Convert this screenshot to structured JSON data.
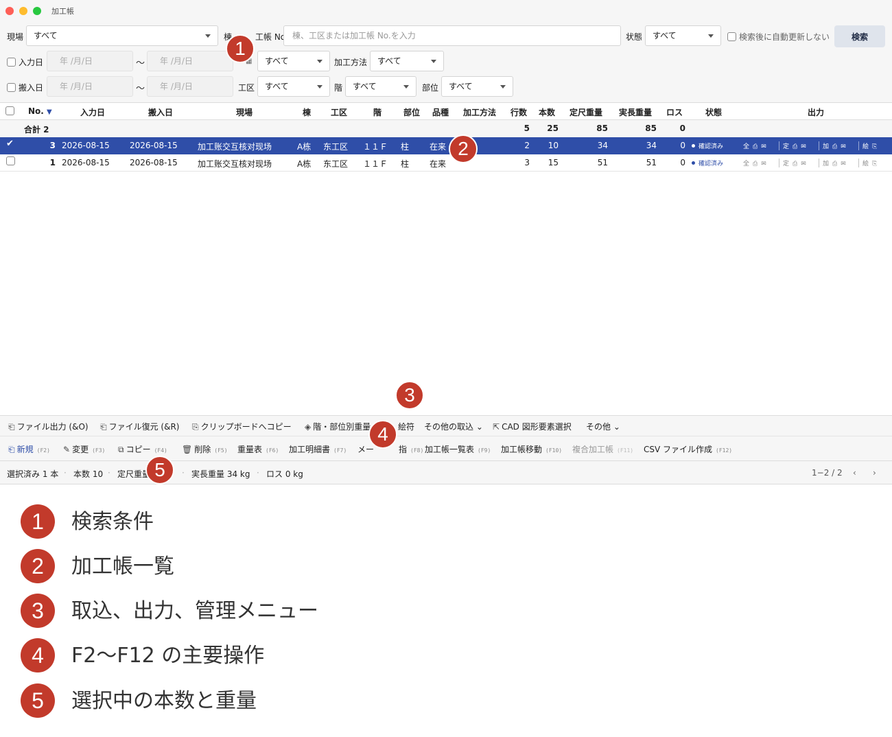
{
  "window": {
    "title": "加工帳"
  },
  "filters": {
    "site_label": "現場",
    "site_value": "すべて",
    "building_label": "棟",
    "ledger_label": "工帳 No.",
    "search_placeholder": "棟、工区または加工帳 No.を入力",
    "state_label": "状態",
    "state_value": "すべて",
    "auto_refresh_label": "検索後に自動更新しない",
    "search_button": "検索",
    "input_date_label": "入力日",
    "date_placeholder": "年 /月/日",
    "tilde": "〜",
    "floor_value": "すべて",
    "method_label": "加工方法",
    "method_value": "すべて",
    "delivery_date_label": "搬入日",
    "zone_label": "工区",
    "zone_value": "すべて",
    "level_label": "階",
    "level_value": "すべて",
    "part_label": "部位",
    "part_value": "すべて"
  },
  "table": {
    "headers": {
      "no": "No.",
      "input_date": "入力日",
      "delivery_date": "搬入日",
      "site": "現場",
      "building": "棟",
      "zone": "工区",
      "floor": "階",
      "part": "部位",
      "item": "品種",
      "method": "加工方法",
      "lines": "行数",
      "count": "本数",
      "fixed_weight": "定尺重量",
      "actual_weight": "実長重量",
      "loss": "ロス",
      "state": "状態",
      "output": "出力"
    },
    "total": {
      "label": "合計 2",
      "lines": "5",
      "count": "25",
      "fixed_weight": "85",
      "actual_weight": "85",
      "loss": "0"
    },
    "rows": [
      {
        "no": "3",
        "input_date": "2026-08-15",
        "delivery_date": "2026-08-15",
        "site": "加工账交互核对现场",
        "building": "A栋",
        "zone": "东工区",
        "floor": "１１Ｆ",
        "part": "柱",
        "item": "在来",
        "lines": "2",
        "count": "10",
        "fixed_weight": "34",
        "actual_weight": "34",
        "loss": "0",
        "state": "確認済み"
      },
      {
        "no": "1",
        "input_date": "2026-08-15",
        "delivery_date": "2026-08-15",
        "site": "加工账交互核对现场",
        "building": "A栋",
        "zone": "东工区",
        "floor": "１１Ｆ",
        "part": "柱",
        "item": "在来",
        "lines": "3",
        "count": "15",
        "fixed_weight": "51",
        "actual_weight": "51",
        "loss": "0",
        "state": "確認済み"
      }
    ],
    "output_groups": [
      "全",
      "定",
      "加",
      "絵"
    ]
  },
  "menu": {
    "file_output": "ファイル出力 (&O)",
    "file_restore": "ファイル復元 (&R)",
    "clipboard_copy": "クリップボードへコピー",
    "floor_weight": "階・部位別重量",
    "drawing": "絵符",
    "other_import": "その他の取込",
    "cad_select": "CAD 図形要素選択",
    "other": "その他"
  },
  "fkeys": {
    "new": "新規",
    "new_key": "(F2)",
    "change": "変更",
    "change_key": "(F3)",
    "copy": "コピー",
    "copy_key": "(F4)",
    "delete": "削除",
    "delete_key": "(F5)",
    "weight_table": "重量表",
    "weight_table_key": "(F6)",
    "detail": "加工明細書",
    "detail_key": "(F7)",
    "maker": "メー",
    "maker_tail": "指",
    "maker_key": "(F8)",
    "list": "加工帳一覧表",
    "list_key": "(F9)",
    "move": "加工帳移動",
    "move_key": "(F10)",
    "composite": "複合加工帳",
    "composite_key": "(F11)",
    "csv": "CSV ファイル作成",
    "csv_key": "(F12)"
  },
  "statusbar": {
    "selected": "選択済み 1 本",
    "count": "本数 10",
    "fixed": "定尺重量",
    "actual": "実長重量 34 kg",
    "loss": "ロス 0 kg",
    "pager": "1−2 / 2"
  },
  "callouts": [
    "1",
    "2",
    "3",
    "4",
    "5"
  ],
  "legend": [
    {
      "num": "1",
      "text": "検索条件"
    },
    {
      "num": "2",
      "text": "加工帳一覧"
    },
    {
      "num": "3",
      "text": "取込、出力、管理メニュー"
    },
    {
      "num": "4",
      "text": "F2〜F12 の主要操作"
    },
    {
      "num": "5",
      "text": "選択中の本数と重量"
    }
  ],
  "colors": {
    "accent": "#2f4ea8",
    "callout": "#c23a2b"
  }
}
